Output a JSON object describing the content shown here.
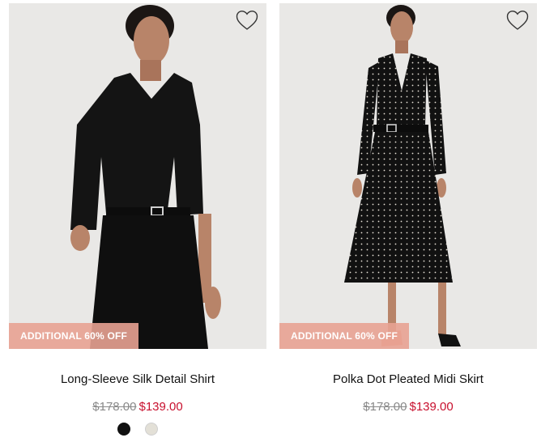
{
  "colors": {
    "badge_bg": "#e8a292",
    "sale_price": "#c8102e",
    "original_price": "#8a8a8a",
    "image_bg": "#e9e8e6"
  },
  "products": [
    {
      "image_alt": "Long-Sleeve Silk Detail Shirt",
      "badge": "ADDITIONAL 60% OFF",
      "name": "Long-Sleeve Silk Detail Shirt",
      "original_price": "$178.00",
      "sale_price": "$139.00",
      "wishlist_icon": "heart-outline-icon",
      "swatches": [
        {
          "label": "black",
          "color": "#111111"
        },
        {
          "label": "ivory",
          "color": "#e3e0d7"
        }
      ]
    },
    {
      "image_alt": "Polka Dot Pleated Midi Skirt",
      "badge": "ADDITIONAL 60% OFF",
      "name": "Polka Dot Pleated Midi Skirt",
      "original_price": "$178.00",
      "sale_price": "$139.00",
      "wishlist_icon": "heart-outline-icon",
      "swatches": []
    }
  ]
}
